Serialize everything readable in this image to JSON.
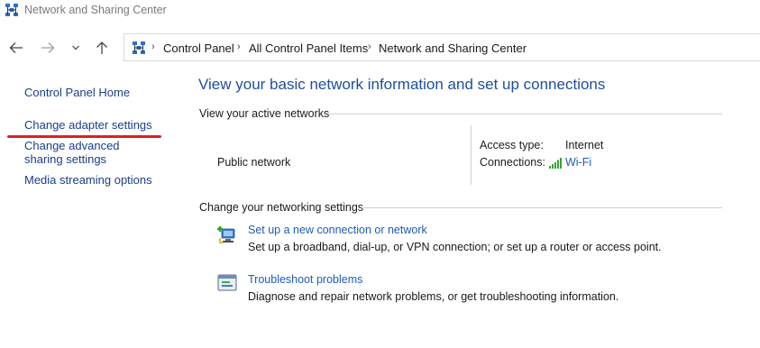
{
  "window": {
    "title": "Network and Sharing Center"
  },
  "address_bar": {
    "breadcrumbs": [
      "Control Panel",
      "All Control Panel Items",
      "Network and Sharing Center"
    ]
  },
  "sidebar": {
    "items": [
      {
        "label": "Control Panel Home"
      },
      {
        "label": "Change adapter settings"
      },
      {
        "label": "Change advanced sharing settings"
      },
      {
        "label": "Media streaming options"
      }
    ]
  },
  "main": {
    "title": "View your basic network information and set up connections",
    "active_networks": {
      "heading": "View your active networks",
      "network_name": "Public network",
      "access_type_label": "Access type:",
      "access_type_value": "Internet",
      "connections_label": "Connections:",
      "connection_name": "Wi-Fi"
    },
    "settings": {
      "heading": "Change your networking settings",
      "tasks": [
        {
          "title": "Set up a new connection or network",
          "description": "Set up a broadband, dial-up, or VPN connection; or set up a router or access point."
        },
        {
          "title": "Troubleshoot problems",
          "description": "Diagnose and repair network problems, or get troubleshooting information."
        }
      ]
    }
  },
  "colors": {
    "link": "#1e5bb8",
    "heading": "#1e4e9e",
    "highlight": "#e02020"
  }
}
